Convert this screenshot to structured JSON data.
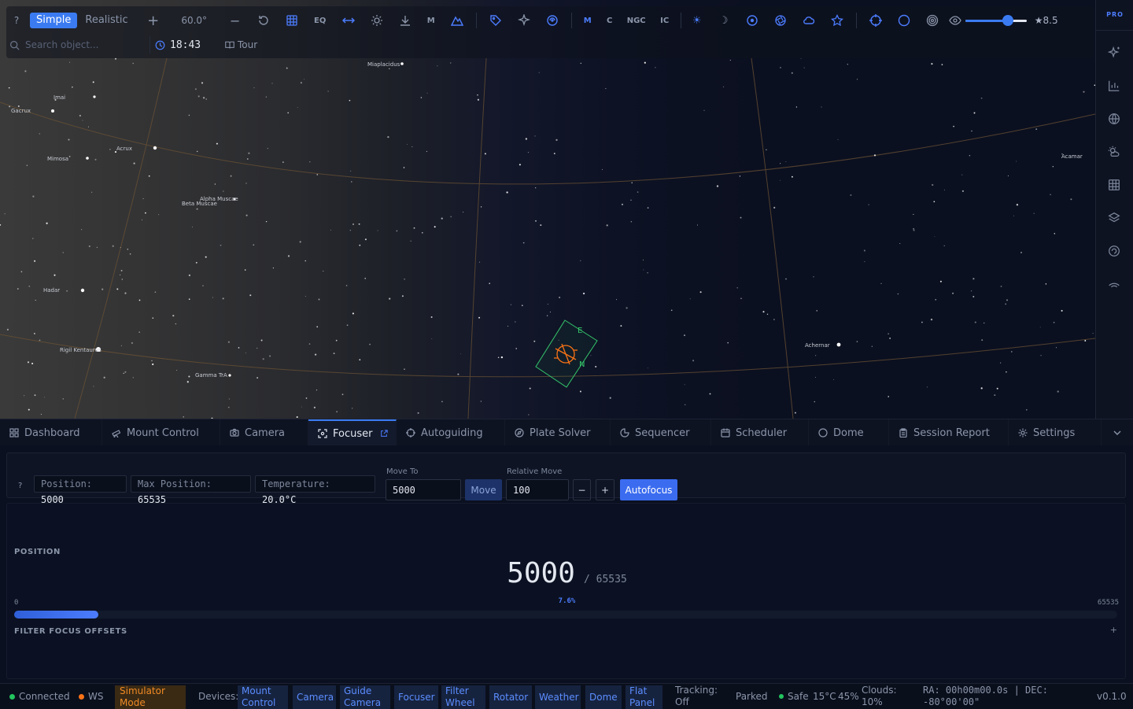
{
  "toolbar": {
    "help": "?",
    "modes": [
      "Simple",
      "Realistic"
    ],
    "fov": "60.0°",
    "text_buttons": {
      "eq": "EQ",
      "m_ground": "M",
      "messier": "M",
      "caldwell": "C",
      "ngc": "NGC",
      "ic": "IC"
    },
    "magnitude_limit": "★8.5",
    "mag_slider_value": 0.7,
    "search_placeholder": "Search object...",
    "time": "18:43",
    "tour": "Tour"
  },
  "sidebar": {
    "badge": "PRO"
  },
  "sky": {
    "star_labels": [
      "Miaplacidus",
      "Imai",
      "Gacrux",
      "Acrux",
      "Mimosa",
      "Alpha Muscae",
      "Beta Muscae",
      "Hadar",
      "Rigil Kentaurus",
      "Gamma TrA",
      "Acamar",
      "Achernar"
    ],
    "fov_labels": {
      "east": "E",
      "north": "N"
    }
  },
  "tabs": [
    "Dashboard",
    "Mount Control",
    "Camera",
    "Focuser",
    "Autoguiding",
    "Plate Solver",
    "Sequencer",
    "Scheduler",
    "Dome",
    "Session Report",
    "Settings"
  ],
  "focuser": {
    "help": "?",
    "position_label": "Position:",
    "position_value": "5000",
    "max_label": "Max Position:",
    "max_value": "65535",
    "temp_label": "Temperature:",
    "temp_value": "20.0°C",
    "move_to_label": "Move To",
    "move_to_value": "5000",
    "move_button": "Move",
    "relative_label": "Relative Move",
    "relative_value": "100",
    "minus": "−",
    "plus": "+",
    "autofocus": "Autofocus",
    "position_section": "POSITION",
    "big_position": "5000",
    "big_max": "/ 65535",
    "percent": "7.6%",
    "percent_fraction": 0.076,
    "range_min": "0",
    "range_max": "65535",
    "offsets_section": "FILTER FOCUS OFFSETS",
    "offsets_add": "+"
  },
  "status": {
    "connected": "Connected",
    "ws": "WS",
    "simulator": "Simulator Mode",
    "devices_label": "Devices:",
    "devices": [
      "Mount Control",
      "Camera",
      "Guide Camera",
      "Focuser",
      "Filter Wheel",
      "Rotator",
      "Weather",
      "Dome",
      "Flat Panel"
    ],
    "tracking": "Tracking: Off",
    "parked": "Parked",
    "safe": "Safe",
    "temp": "15°C",
    "humidity": "45%",
    "clouds": "Clouds: 10%",
    "coords": "RA: 00h00m00.0s | DEC: -80°00'00\"",
    "version": "v0.1.0",
    "colors": {
      "connected": "#22c55e",
      "ws": "#f97316",
      "safe": "#22c55e"
    }
  }
}
